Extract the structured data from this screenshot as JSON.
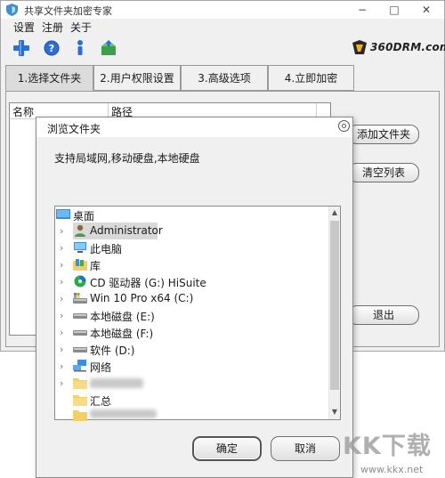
{
  "app": {
    "title": "共享文件夹加密专家",
    "brand": "360DRM.com",
    "menu": [
      "设置",
      "注册",
      "关于"
    ],
    "toolbar_icons": [
      "add-icon",
      "help-icon",
      "info-icon",
      "open-icon"
    ],
    "window_controls": [
      "−",
      "□",
      "✕"
    ]
  },
  "tabs": [
    {
      "label": "1.选择文件夹",
      "active": true
    },
    {
      "label": "2.用户权限设置",
      "active": false
    },
    {
      "label": "3.高级选项",
      "active": false
    },
    {
      "label": "4.立即加密",
      "active": false
    }
  ],
  "list": {
    "columns": [
      "名称",
      "路径"
    ]
  },
  "side_buttons": {
    "add": "添加文件夹",
    "clear": "清空列表",
    "exit": "退出"
  },
  "dialog": {
    "title": "浏览文件夹",
    "description": "支持局域网,移动硬盘,本地硬盘",
    "tree": [
      {
        "label": "桌面",
        "icon": "desktop-icon",
        "expand": "",
        "level": 0
      },
      {
        "label": "Administrator",
        "icon": "user-icon",
        "expand": "›",
        "level": 1,
        "selected": true
      },
      {
        "label": "此电脑",
        "icon": "computer-icon",
        "expand": "›",
        "level": 1
      },
      {
        "label": "库",
        "icon": "library-icon",
        "expand": "›",
        "level": 1
      },
      {
        "label": "CD 驱动器 (G:) HiSuite",
        "icon": "cd-drive-icon",
        "expand": "›",
        "level": 1
      },
      {
        "label": "Win 10 Pro x64 (C:)",
        "icon": "system-drive-icon",
        "expand": "›",
        "level": 1
      },
      {
        "label": "本地磁盘 (E:)",
        "icon": "disk-drive-icon",
        "expand": "›",
        "level": 1
      },
      {
        "label": "本地磁盘 (F:)",
        "icon": "disk-drive-icon",
        "expand": "›",
        "level": 1
      },
      {
        "label": "软件 (D:)",
        "icon": "disk-drive-icon",
        "expand": "›",
        "level": 1
      },
      {
        "label": "网络",
        "icon": "network-icon",
        "expand": "›",
        "level": 1
      },
      {
        "label": "",
        "icon": "folder-icon",
        "expand": "›",
        "level": 1
      },
      {
        "label": "汇总",
        "icon": "folder-icon",
        "expand": "",
        "level": 1
      },
      {
        "label": "",
        "icon": "folder-icon",
        "expand": "",
        "level": 1
      }
    ],
    "ok": "确定",
    "cancel": "取消"
  },
  "watermark": {
    "logo": "KK下载",
    "url": "www.kkx.net"
  },
  "colors": {
    "window_bg": "#f0f0f0",
    "selection": "#d9d9d9",
    "folder_yellow": "#f4cf66",
    "toolbar_blue": "#2b6fd6"
  }
}
